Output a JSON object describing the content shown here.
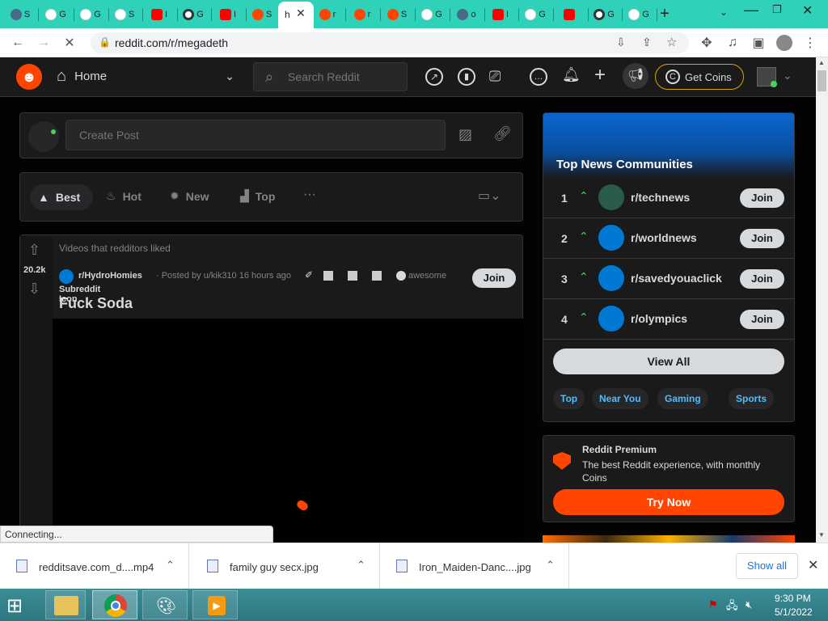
{
  "tabs": [
    {
      "icon": "globe-icon",
      "label": "S",
      "kind": "w"
    },
    {
      "icon": "google-icon",
      "label": "G",
      "kind": "g"
    },
    {
      "icon": "google-icon",
      "label": "G",
      "kind": "g"
    },
    {
      "icon": "audio-icon",
      "label": "S",
      "kind": "g"
    },
    {
      "icon": "youtube-icon",
      "label": "I",
      "kind": "y"
    },
    {
      "icon": "chrome-icon",
      "label": "G",
      "kind": "c"
    },
    {
      "icon": "youtube-icon",
      "label": "I",
      "kind": "y"
    },
    {
      "icon": "reddit-icon",
      "label": "S",
      "kind": "r"
    },
    {
      "icon": "reddit-icon",
      "label": "r",
      "kind": "r"
    },
    {
      "icon": "reddit-icon",
      "label": "r",
      "kind": "r"
    },
    {
      "icon": "reddit-icon",
      "label": "S",
      "kind": "r"
    },
    {
      "icon": "google-icon",
      "label": "G",
      "kind": "g"
    },
    {
      "icon": "globe-icon",
      "label": "o",
      "kind": "w"
    },
    {
      "icon": "alert-icon",
      "label": "I",
      "kind": "y"
    },
    {
      "icon": "google-icon",
      "label": "G",
      "kind": "g"
    },
    {
      "icon": "youtube-icon",
      "label": "",
      "kind": "y"
    },
    {
      "icon": "chrome-icon",
      "label": "G",
      "kind": "c"
    },
    {
      "icon": "google-icon",
      "label": "G",
      "kind": "g"
    }
  ],
  "active_tab": {
    "label": "h"
  },
  "address": {
    "url": "reddit.com/r/megadeth"
  },
  "reddit": {
    "home_label": "Home",
    "search_placeholder": "Search Reddit",
    "get_coins": "Get Coins",
    "create_post_placeholder": "Create Post",
    "sort": {
      "best": "Best",
      "hot": "Hot",
      "new": "New",
      "top": "Top",
      "more": "···"
    },
    "post": {
      "context": "Videos that redditors liked",
      "votes": "20.2k",
      "subreddit": "r/HydroHomies",
      "meta": "· Posted by u/kik310 16 hours ago",
      "icon_alt": "Subreddit Icon",
      "award_text": "awesome",
      "title": "Fuck Soda",
      "join": "Join"
    },
    "top_news": {
      "title": "Top News Communities",
      "items": [
        {
          "rank": "1",
          "name": "r/technews",
          "join": "Join",
          "color": "#2a5a4a"
        },
        {
          "rank": "2",
          "name": "r/worldnews",
          "join": "Join",
          "color": "#0079d3"
        },
        {
          "rank": "3",
          "name": "r/savedyouaclick",
          "join": "Join",
          "color": "#0079d3"
        },
        {
          "rank": "4",
          "name": "r/olympics",
          "join": "Join",
          "color": "#0079d3"
        }
      ],
      "view_all": "View All",
      "chips": [
        "Top",
        "Near You",
        "Gaming",
        "Sports"
      ]
    },
    "premium": {
      "title": "Reddit Premium",
      "desc": "The best Reddit experience, with monthly Coins",
      "cta": "Try Now"
    }
  },
  "status_text": "Connecting...",
  "downloads": [
    {
      "name": "redditsave.com_d....mp4"
    },
    {
      "name": "family guy secx.jpg"
    },
    {
      "name": "Iron_Maiden-Danc....jpg"
    }
  ],
  "show_all": "Show all",
  "clock": {
    "time": "9:30 PM",
    "date": "5/1/2022"
  }
}
